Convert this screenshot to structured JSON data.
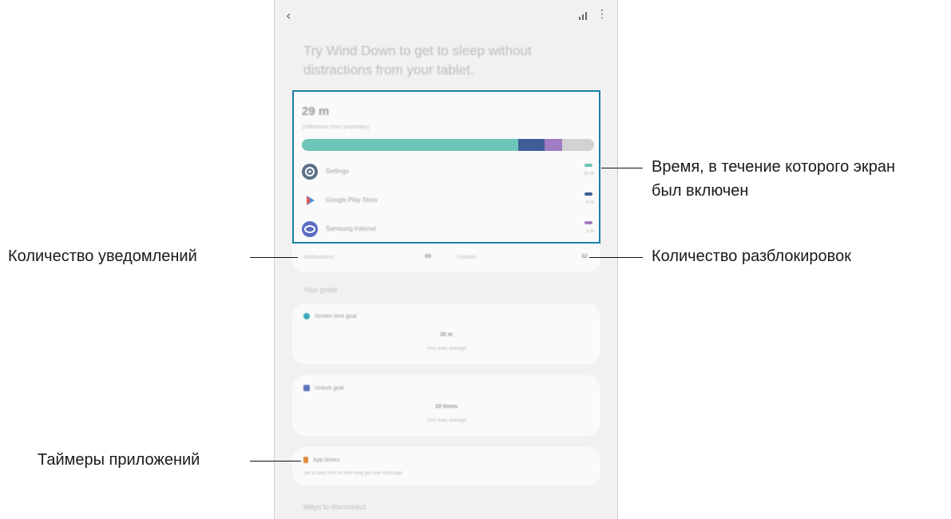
{
  "screen": {
    "headline": "Try Wind Down to get to sleep without distractions from your tablet.",
    "usage": {
      "total_time": "29 m",
      "caption": "(Difference from yesterday)",
      "bar_segments": [
        {
          "color": "#6ec6b8",
          "fraction": 0.74
        },
        {
          "color": "#3f5d96",
          "fraction": 0.09
        },
        {
          "color": "#a07cc4",
          "fraction": 0.06
        },
        {
          "color": "#d2d2d2",
          "fraction": 0.11
        }
      ],
      "apps": [
        {
          "name": "Settings",
          "time": "20 m",
          "icon": "settings-icon",
          "color": "#6ec6b8"
        },
        {
          "name": "Google Play Store",
          "time": "6 m",
          "icon": "play-store-icon",
          "color": "#3f5d96"
        },
        {
          "name": "Samsung Internet",
          "time": "1 m",
          "icon": "internet-icon",
          "color": "#a07cc4"
        }
      ]
    },
    "stats": {
      "notifications_label": "Notifications",
      "notifications_value": "88",
      "unlocks_label": "Unlocks",
      "unlocks_value": "32"
    },
    "goals_title": "Your goals",
    "screen_time_goal": {
      "label": "Screen time goal",
      "value": "30 m",
      "sub": "Your daily average"
    },
    "unlock_goal": {
      "label": "Unlock goal",
      "value": "10 times",
      "sub": "Your daily average"
    },
    "app_timers": {
      "label": "App timers",
      "sub": "Set a daily limit for how long you use each app"
    },
    "bottom_section": "Ways to disconnect"
  },
  "callouts": {
    "screen_time_line1": "Время, в течение которого экран",
    "screen_time_line2": "был включен",
    "notifications": "Количество уведомлений",
    "unlocks": "Количество разблокировок",
    "app_timers": "Таймеры приложений"
  }
}
